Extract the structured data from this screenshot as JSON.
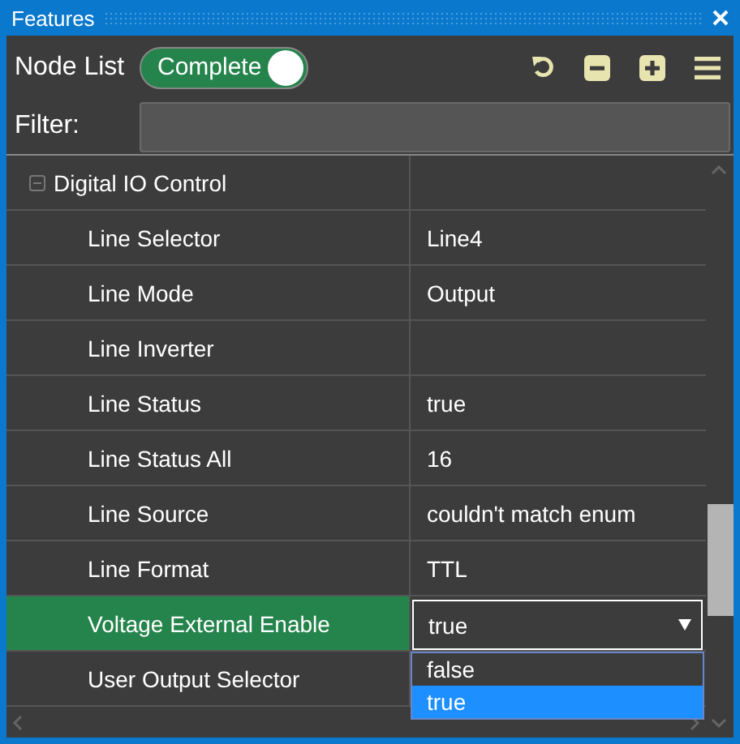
{
  "window": {
    "title": "Features"
  },
  "toolbar": {
    "label": "Node List",
    "toggle": {
      "label": "Complete",
      "on": true
    }
  },
  "filter": {
    "label": "Filter:"
  },
  "tree": [
    {
      "name": "Digital IO Control",
      "expanded": true,
      "children": [
        {
          "name": "Line Selector",
          "value": "Line4",
          "kind": "text",
          "selected": false
        },
        {
          "name": "Line Mode",
          "value": "Output",
          "kind": "text",
          "selected": false
        },
        {
          "name": "Line Inverter",
          "kind": "text",
          "selected": false
        },
        {
          "name": "Line Status",
          "value": "true",
          "kind": "text",
          "selected": false
        },
        {
          "name": "Line Status All",
          "value": "16",
          "kind": "text",
          "selected": false
        },
        {
          "name": "Line Source",
          "value": "couldn't match enum",
          "kind": "text",
          "selected": false
        },
        {
          "name": "Line Format",
          "value": "TTL",
          "kind": "text",
          "selected": false
        },
        {
          "name": "Voltage External Enable",
          "value": "true",
          "kind": "dropdown",
          "selected": true,
          "expanded": true,
          "options": [
            {
              "label": "false",
              "selected": false
            },
            {
              "label": "true",
              "selected": true
            }
          ]
        },
        {
          "name": "User Output Selector",
          "kind": "text",
          "selected": false
        }
      ]
    }
  ]
}
